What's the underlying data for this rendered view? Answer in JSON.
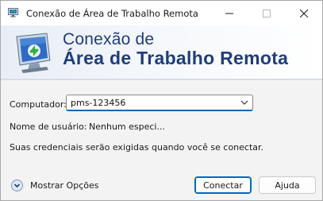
{
  "window": {
    "title": "Conexão de Área de Trabalho Remota"
  },
  "banner": {
    "line1": "Conexão de",
    "line2": "Área de Trabalho Remota"
  },
  "form": {
    "computer_label": "Computador:",
    "computer_value": "pms-123456",
    "username_label": "Nome de usuário:",
    "username_value": "Nenhum especi...",
    "credentials_message": "Suas credenciais serão exigidas quando você se conectar."
  },
  "footer": {
    "options_label": "Mostrar Opções",
    "connect_label": "Conectar",
    "help_label": "Ajuda"
  },
  "colors": {
    "accent": "#0067c0",
    "banner_text": "#1f3d7a"
  },
  "icons": {
    "app": "remote-desktop-icon",
    "minimize": "minimize-icon",
    "maximize": "maximize-icon",
    "close": "close-icon",
    "dropdown": "chevron-down-icon",
    "options": "expand-circle-icon"
  }
}
